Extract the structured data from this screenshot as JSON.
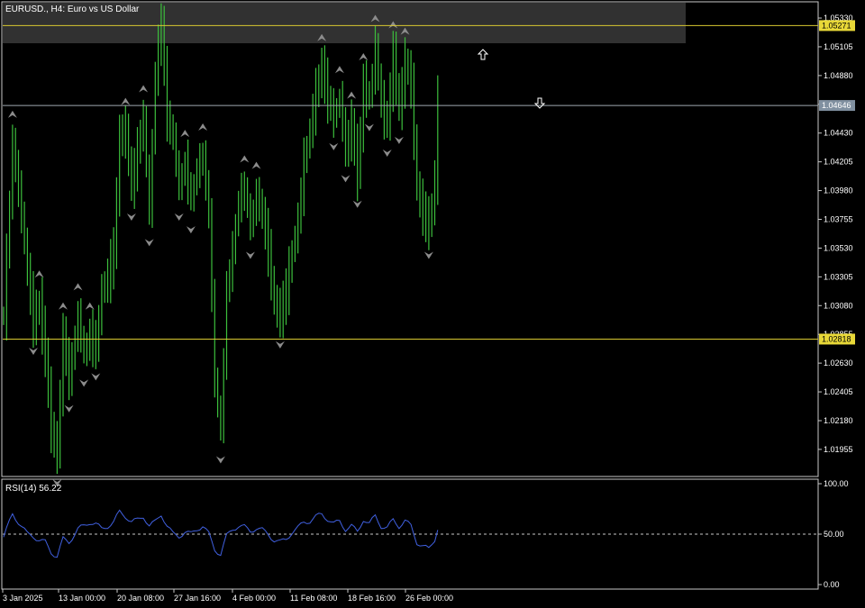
{
  "window": {
    "title": "EURUSD., H4:  Euro vs US Dollar"
  },
  "colors": {
    "background": "#000000",
    "frame": "#c8c8c8",
    "candle": "#3cbf3c",
    "fractal": "#8c8c8c",
    "level_line": "#d8c830",
    "price_line": "#a0a8b0",
    "rsi_line": "#4060e0",
    "zone": "#3a3a3a"
  },
  "indicator": {
    "label": "RSI(14) 56.22",
    "ticks": [
      "100.00",
      "50.00",
      "0.00"
    ],
    "ylim": [
      0,
      100
    ],
    "midline": 50
  },
  "price_axis": {
    "ticks": [
      "1.05330",
      "1.05105",
      "1.04880",
      "1.04655",
      "1.04430",
      "1.04205",
      "1.03980",
      "1.03755",
      "1.03530",
      "1.03305",
      "1.03080",
      "1.02855",
      "1.02630",
      "1.02405",
      "1.02180",
      "1.01955"
    ],
    "ylim": [
      1.0175,
      1.0545
    ]
  },
  "levels": {
    "upper": {
      "value": 1.05271,
      "label": "1.05271"
    },
    "current": {
      "value": 1.04646,
      "label": "1.04646"
    },
    "lower": {
      "value": 1.02818,
      "label": "1.02818"
    }
  },
  "time_axis": {
    "labels": [
      "3 Jan 2025",
      "13 Jan 00:00",
      "20 Jan 08:00",
      "27 Jan 16:00",
      "4 Feb 00:00",
      "11 Feb 08:00",
      "18 Feb 16:00",
      "26 Feb 00:00"
    ]
  },
  "markers": {
    "up_arrow": "up-arrow-icon",
    "down_arrow": "down-arrow-icon"
  },
  "chart_data": {
    "type": "bar",
    "symbol": "EURUSD.",
    "timeframe": "H4",
    "keypoints_close": [
      [
        0,
        1.03
      ],
      [
        3,
        1.0435
      ],
      [
        6,
        1.038
      ],
      [
        8,
        1.0335
      ],
      [
        10,
        1.0295
      ],
      [
        12,
        1.031
      ],
      [
        14,
        1.027
      ],
      [
        16,
        1.0212
      ],
      [
        18,
        1.0192
      ],
      [
        20,
        1.0285
      ],
      [
        22,
        1.025
      ],
      [
        25,
        1.03
      ],
      [
        27,
        1.027
      ],
      [
        29,
        1.0285
      ],
      [
        31,
        1.0275
      ],
      [
        33,
        1.032
      ],
      [
        35,
        1.033
      ],
      [
        37,
        1.035
      ],
      [
        39,
        1.044
      ],
      [
        41,
        1.0445
      ],
      [
        43,
        1.04
      ],
      [
        45,
        1.043
      ],
      [
        47,
        1.0455
      ],
      [
        49,
        1.038
      ],
      [
        51,
        1.049
      ],
      [
        53,
        1.053
      ],
      [
        55,
        1.0455
      ],
      [
        57,
        1.044
      ],
      [
        59,
        1.04
      ],
      [
        61,
        1.042
      ],
      [
        63,
        1.039
      ],
      [
        65,
        1.0415
      ],
      [
        67,
        1.0425
      ],
      [
        69,
        1.038
      ],
      [
        71,
        1.025
      ],
      [
        73,
        1.021
      ],
      [
        75,
        1.032
      ],
      [
        77,
        1.035
      ],
      [
        79,
        1.039
      ],
      [
        81,
        1.04
      ],
      [
        83,
        1.037
      ],
      [
        85,
        1.0395
      ],
      [
        87,
        1.038
      ],
      [
        89,
        1.035
      ],
      [
        91,
        1.031
      ],
      [
        93,
        1.03
      ],
      [
        95,
        1.032
      ],
      [
        97,
        1.035
      ],
      [
        99,
        1.0375
      ],
      [
        101,
        1.042
      ],
      [
        103,
        1.0445
      ],
      [
        105,
        1.0475
      ],
      [
        107,
        1.0495
      ],
      [
        109,
        1.047
      ],
      [
        111,
        1.0455
      ],
      [
        113,
        1.047
      ],
      [
        115,
        1.043
      ],
      [
        117,
        1.045
      ],
      [
        119,
        1.041
      ],
      [
        121,
        1.048
      ],
      [
        123,
        1.047
      ],
      [
        125,
        1.051
      ],
      [
        127,
        1.0465
      ],
      [
        129,
        1.045
      ],
      [
        131,
        1.0505
      ],
      [
        133,
        1.046
      ],
      [
        135,
        1.05
      ],
      [
        137,
        1.048
      ],
      [
        139,
        1.04
      ],
      [
        141,
        1.038
      ],
      [
        143,
        1.037
      ],
      [
        145,
        1.0405
      ],
      [
        146,
        1.047
      ]
    ],
    "rsi_keypoints": [
      [
        0,
        47
      ],
      [
        3,
        70
      ],
      [
        6,
        58
      ],
      [
        8,
        50
      ],
      [
        10,
        48
      ],
      [
        12,
        44
      ],
      [
        14,
        42
      ],
      [
        16,
        32
      ],
      [
        18,
        28
      ],
      [
        20,
        45
      ],
      [
        22,
        42
      ],
      [
        25,
        55
      ],
      [
        27,
        58
      ],
      [
        29,
        62
      ],
      [
        31,
        60
      ],
      [
        33,
        55
      ],
      [
        35,
        58
      ],
      [
        37,
        62
      ],
      [
        39,
        72
      ],
      [
        41,
        68
      ],
      [
        43,
        62
      ],
      [
        45,
        64
      ],
      [
        47,
        68
      ],
      [
        49,
        58
      ],
      [
        51,
        62
      ],
      [
        53,
        70
      ],
      [
        55,
        58
      ],
      [
        57,
        50
      ],
      [
        59,
        48
      ],
      [
        61,
        52
      ],
      [
        63,
        50
      ],
      [
        65,
        55
      ],
      [
        67,
        58
      ],
      [
        69,
        50
      ],
      [
        71,
        35
      ],
      [
        73,
        30
      ],
      [
        75,
        48
      ],
      [
        77,
        55
      ],
      [
        79,
        58
      ],
      [
        81,
        57
      ],
      [
        83,
        53
      ],
      [
        85,
        56
      ],
      [
        87,
        54
      ],
      [
        89,
        50
      ],
      [
        91,
        44
      ],
      [
        93,
        42
      ],
      [
        95,
        45
      ],
      [
        97,
        52
      ],
      [
        99,
        56
      ],
      [
        101,
        62
      ],
      [
        103,
        63
      ],
      [
        105,
        67
      ],
      [
        107,
        70
      ],
      [
        109,
        65
      ],
      [
        111,
        60
      ],
      [
        113,
        63
      ],
      [
        115,
        55
      ],
      [
        117,
        58
      ],
      [
        119,
        52
      ],
      [
        121,
        65
      ],
      [
        123,
        60
      ],
      [
        125,
        68
      ],
      [
        127,
        58
      ],
      [
        129,
        56
      ],
      [
        131,
        64
      ],
      [
        133,
        58
      ],
      [
        135,
        63
      ],
      [
        137,
        58
      ],
      [
        139,
        42
      ],
      [
        141,
        38
      ],
      [
        143,
        35
      ],
      [
        145,
        45
      ],
      [
        146,
        56
      ]
    ],
    "ylim": [
      1.0175,
      1.0545
    ],
    "xlabels": [
      "3 Jan 2025",
      "13 Jan 00:00",
      "20 Jan 08:00",
      "27 Jan 16:00",
      "4 Feb 00:00",
      "11 Feb 08:00",
      "18 Feb 16:00",
      "26 Feb 00:00"
    ]
  }
}
